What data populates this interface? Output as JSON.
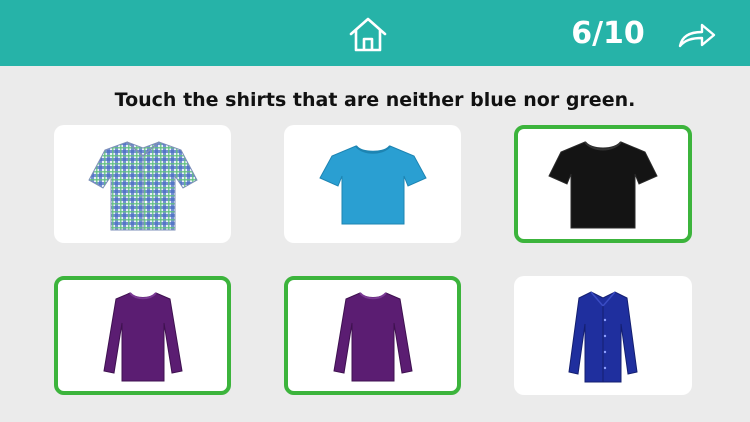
{
  "header": {
    "progress_text": "6/10",
    "bar_color": "#26b3a8",
    "home_icon": "home-icon",
    "next_icon": "forward-arrow-icon"
  },
  "question": {
    "text": "Touch the shirts that are neither blue nor green."
  },
  "options": [
    {
      "item": "plaid-button-up-shirt",
      "color": "blue-green-plaid",
      "selected": false
    },
    {
      "item": "t-shirt",
      "color": "blue",
      "selected": false
    },
    {
      "item": "t-shirt",
      "color": "black",
      "selected": true
    },
    {
      "item": "long-sleeve-shirt",
      "color": "purple",
      "selected": true
    },
    {
      "item": "long-sleeve-shirt",
      "color": "purple",
      "selected": true
    },
    {
      "item": "button-up-blouse",
      "color": "blue",
      "selected": false
    }
  ],
  "colors": {
    "selected_border": "#3cb43c",
    "background": "#ebebeb"
  }
}
